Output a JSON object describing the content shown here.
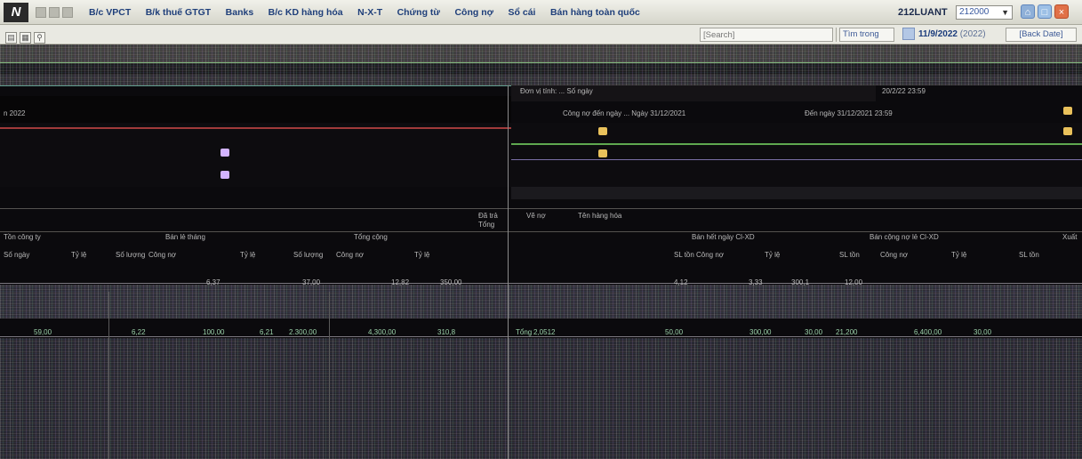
{
  "menubar": {
    "logo": "N",
    "items": [
      "B/c VPCT",
      "B/k thuế GTGT",
      "Banks",
      "B/c KD hàng hóa",
      "N-X-T",
      "Chứng từ",
      "Công nợ",
      "Sổ cái",
      "Bán hàng toàn quốc"
    ],
    "company_code": "212LUANT",
    "company_select": "212000"
  },
  "toolbar": {
    "search_placeholder": "[Search]",
    "find_label": "Tìm trong",
    "date": "11/9/2022",
    "year": "(2022)",
    "back_date": "[Back Date]"
  },
  "report": {
    "fragments": [
      "n 2022",
      "Đơn vị tính: ... Số ngày",
      "20/2/22 23:59",
      "Công nợ đến ngày ... Ngày 31/12/2021",
      "Đến ngày 31/12/2021 23:59",
      "Đã trả",
      "Tổng",
      "Vẽ nợ",
      "Tên hàng hóa",
      "Tồn công ty",
      "Bán lẻ tháng",
      "Tổng cộng",
      "Bán hết ngày Cl-XD",
      "Bán cộng nợ lẻ Cl-XD",
      "SL tồn",
      "Xuất",
      "Số ngày",
      "Số lượng",
      "Tỷ lệ",
      "Công nợ",
      "6,37",
      "37,00",
      "12,82",
      "350,00",
      "4,12",
      "3,33",
      "300,1",
      "12,00",
      "59,00",
      "6,22",
      "100,00",
      "6,21",
      "2.300,00",
      "4,300,00",
      "310,8",
      "Tổng",
      "2,0512",
      "50,00",
      "300,00",
      "30,00",
      "21,200",
      "6,400,00",
      "30,00"
    ]
  }
}
